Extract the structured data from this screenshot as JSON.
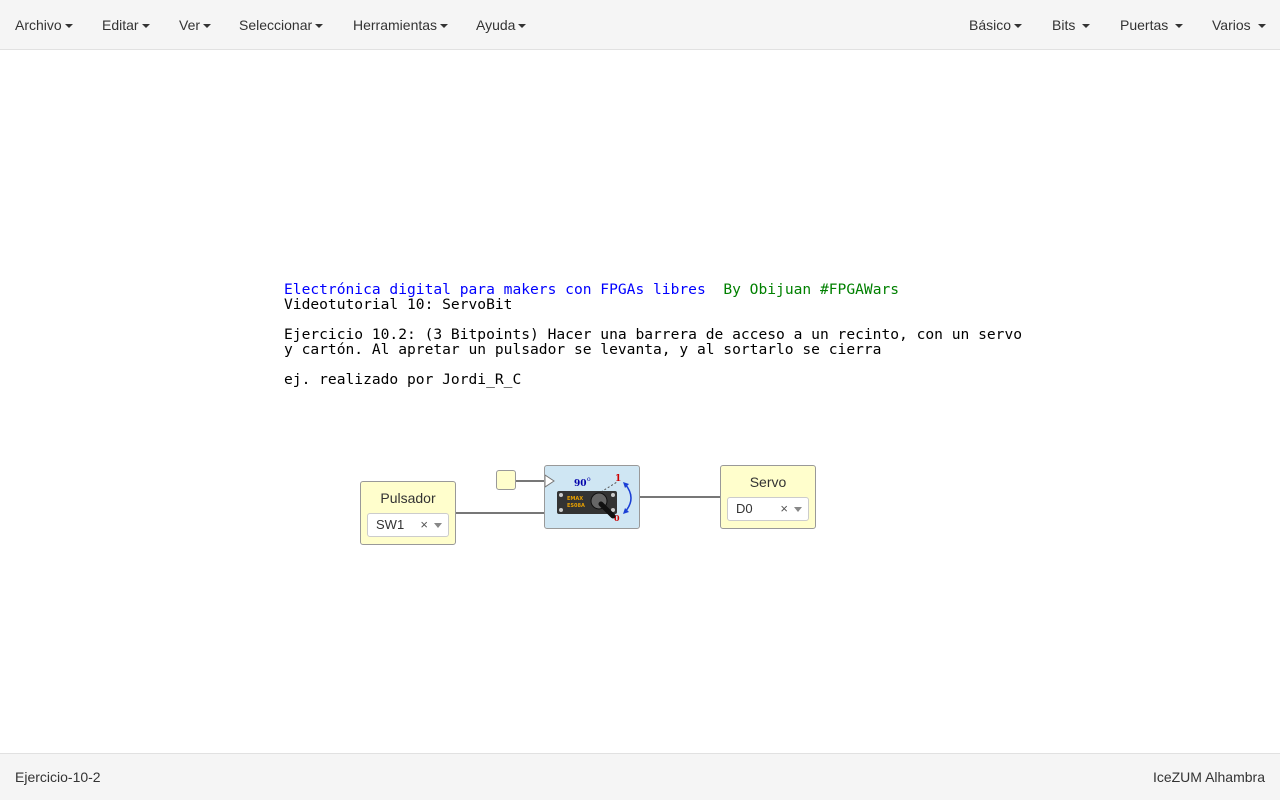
{
  "menu_left": [
    "Archivo",
    "Editar",
    "Ver",
    "Seleccionar",
    "Herramientas",
    "Ayuda"
  ],
  "menu_right": [
    "Básico",
    "Bits",
    "Puertas",
    "Varios"
  ],
  "info": {
    "line1_blue": "Electrónica digital para makers con FPGAs libres",
    "line1_green": "By Obijuan #FPGAWars",
    "line2": "Videotutorial 10: ServoBit",
    "line3": "Ejercicio 10.2: (3 Bitpoints) Hacer una barrera de acceso a un recinto, con un servo",
    "line4": "y cartón. Al apretar un pulsador se levanta, y al sortarlo se cierra",
    "line5": "ej. realizado por Jordi_R_C"
  },
  "blocks": {
    "pulsador": {
      "title": "Pulsador",
      "pin": "SW1",
      "clear": "×"
    },
    "servo": {
      "title": "Servo",
      "pin": "D0",
      "clear": "×"
    },
    "servo_bit": {
      "angle": "90",
      "degree": "o",
      "one": "1",
      "zero": "0",
      "servo_text1": "EMAX",
      "servo_text2": "ES08A"
    }
  },
  "colors": {
    "block_fill": "#fffecc",
    "module_fill": "#cfe6f3",
    "info_blue": "#0000ff",
    "info_green": "#008000"
  },
  "status": {
    "file": "Ejercicio-10-2",
    "board": "IceZUM Alhambra"
  }
}
